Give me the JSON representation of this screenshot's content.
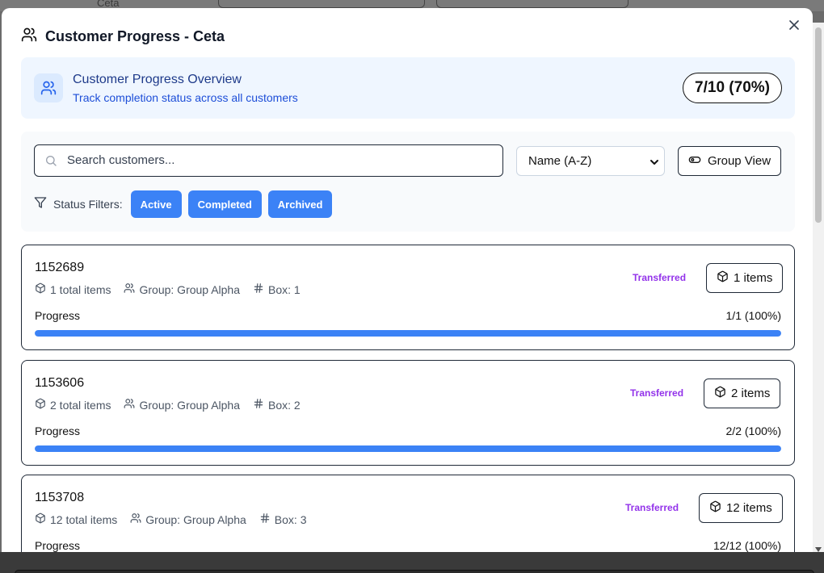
{
  "backdrop": {
    "ghost_text": "Ceta"
  },
  "modal": {
    "title": "Customer Progress - Ceta",
    "close_icon": "close-icon"
  },
  "overview": {
    "title": "Customer Progress Overview",
    "subtitle": "Track completion status across all customers",
    "badge": "7/10 (70%)"
  },
  "controls": {
    "search_placeholder": "Search customers...",
    "sort_value": "Name (A-Z)",
    "group_view_label": "Group View",
    "filters_label": "Status Filters:",
    "filter_chips": [
      "Active",
      "Completed",
      "Archived"
    ]
  },
  "customers": [
    {
      "id": "1152689",
      "total_items": "1 total items",
      "group": "Group: Group Alpha",
      "box": "Box: 1",
      "status": "Transferred",
      "items_label": "1 items",
      "progress_label": "Progress",
      "progress_text": "1/1 (100%)",
      "progress_fraction": 1.0
    },
    {
      "id": "1153606",
      "total_items": "2 total items",
      "group": "Group: Group Alpha",
      "box": "Box: 2",
      "status": "Transferred",
      "items_label": "2 items",
      "progress_label": "Progress",
      "progress_text": "2/2 (100%)",
      "progress_fraction": 1.0
    },
    {
      "id": "1153708",
      "total_items": "12 total items",
      "group": "Group: Group Alpha",
      "box": "Box: 3",
      "status": "Transferred",
      "items_label": "12 items",
      "progress_label": "Progress",
      "progress_text": "12/12 (100%)",
      "progress_fraction": 1.0
    }
  ],
  "colors": {
    "accent": "#3b82f6",
    "status_transferred": "#9333ea",
    "overview_bg": "#eff6ff"
  }
}
